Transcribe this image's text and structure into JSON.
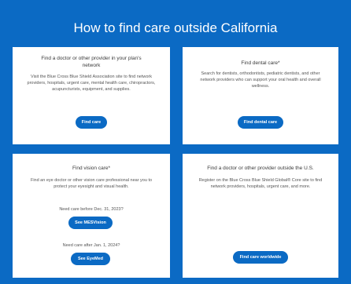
{
  "page": {
    "title": "How to find care outside California"
  },
  "cards": [
    {
      "heading": "Find a doctor or other provider in your plan's network",
      "body": "Visit the Blue Cross Blue Shield Association site to find network providers, hospitals, urgent care, mental health care, chiropractors, acupuncturists, equipment, and supplies.",
      "button": "Find care"
    },
    {
      "heading": "Find dental care*",
      "body": "Search for dentists, orthodontists, pediatric dentists, and other network providers who can support your oral health and overall wellness.",
      "button": "Find dental care"
    },
    {
      "heading": "Find vision care*",
      "body": "Find an eye doctor or other vision care professional near you to protect your eyesight and visual health.",
      "question1": "Need care before Dec. 31, 2023?",
      "button1": "See MESVision",
      "question2": "Need care after Jan. 1, 2024?",
      "button2": "See EyeMed"
    },
    {
      "heading": "Find a doctor or other provider outside the U.S.",
      "body": "Register on the Blue Cross Blue Shield Global® Core site to find network providers, hospitals, urgent care, and more.",
      "button": "Find care worldwide"
    }
  ],
  "colors": {
    "brand_blue": "#0b6ac4",
    "card_bg": "#ffffff"
  }
}
